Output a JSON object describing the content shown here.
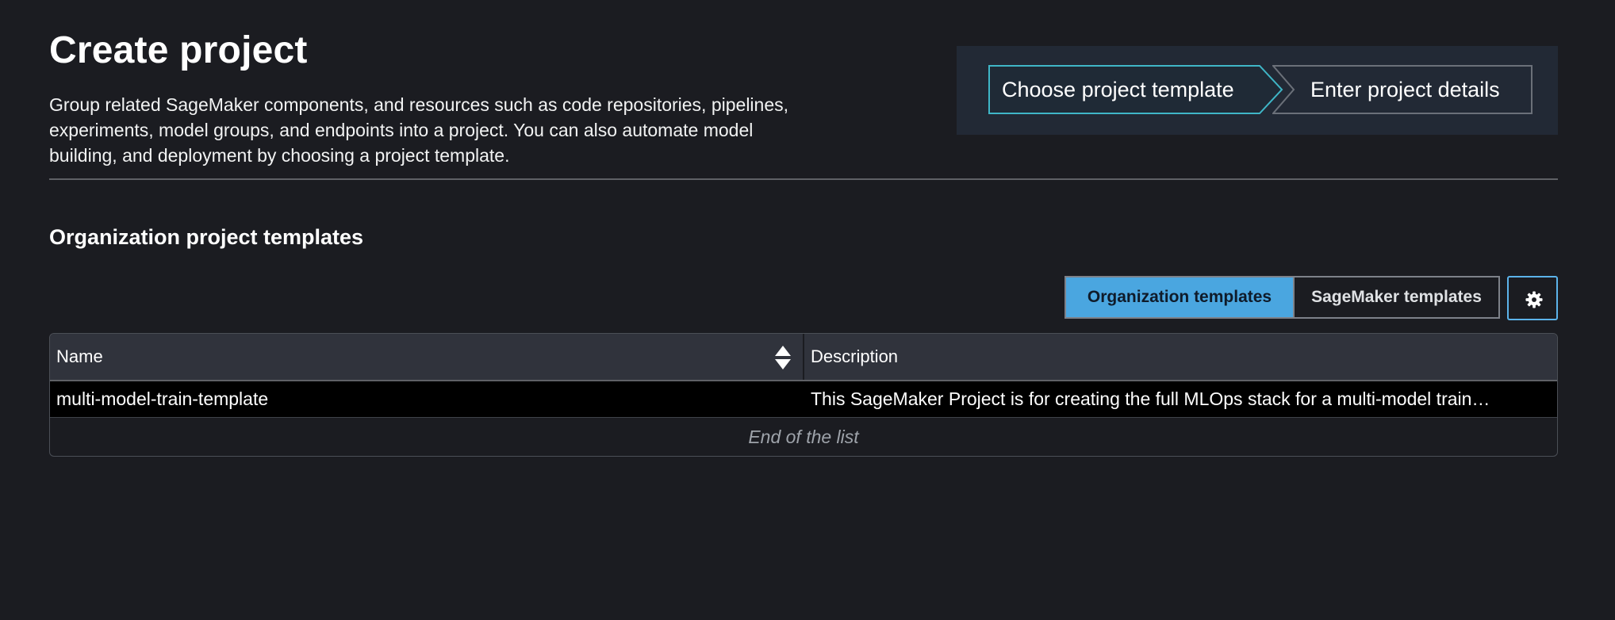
{
  "header": {
    "title": "Create project",
    "description": "Group related SageMaker components, and resources such as code repositories, pipelines, experiments, model groups, and endpoints into a project. You can also automate model building, and deployment by choosing a project template."
  },
  "stepper": {
    "steps": [
      {
        "label": "Choose project template",
        "state": "active"
      },
      {
        "label": "Enter project details",
        "state": "inactive"
      }
    ]
  },
  "section": {
    "title": "Organization project templates"
  },
  "template_source": {
    "options": [
      {
        "label": "Organization templates",
        "selected": true
      },
      {
        "label": "SageMaker templates",
        "selected": false
      }
    ],
    "settings_icon": "gear-icon"
  },
  "table": {
    "columns": [
      {
        "label": "Name",
        "sortable": true,
        "sort_icon": "sort-up-down-icon"
      },
      {
        "label": "Description",
        "sortable": false
      }
    ],
    "rows": [
      {
        "name": "multi-model-train-template",
        "description": "This SageMaker Project is for creating the full MLOps stack for a multi-model train…"
      }
    ],
    "end_text": "End of the list"
  },
  "colors": {
    "background": "#1b1c21",
    "stepper_panel": "#222935",
    "accent": "#4aa6e0",
    "active_step_border": "#3fb6c7",
    "table_header": "#30333c",
    "row_background": "#000000"
  }
}
